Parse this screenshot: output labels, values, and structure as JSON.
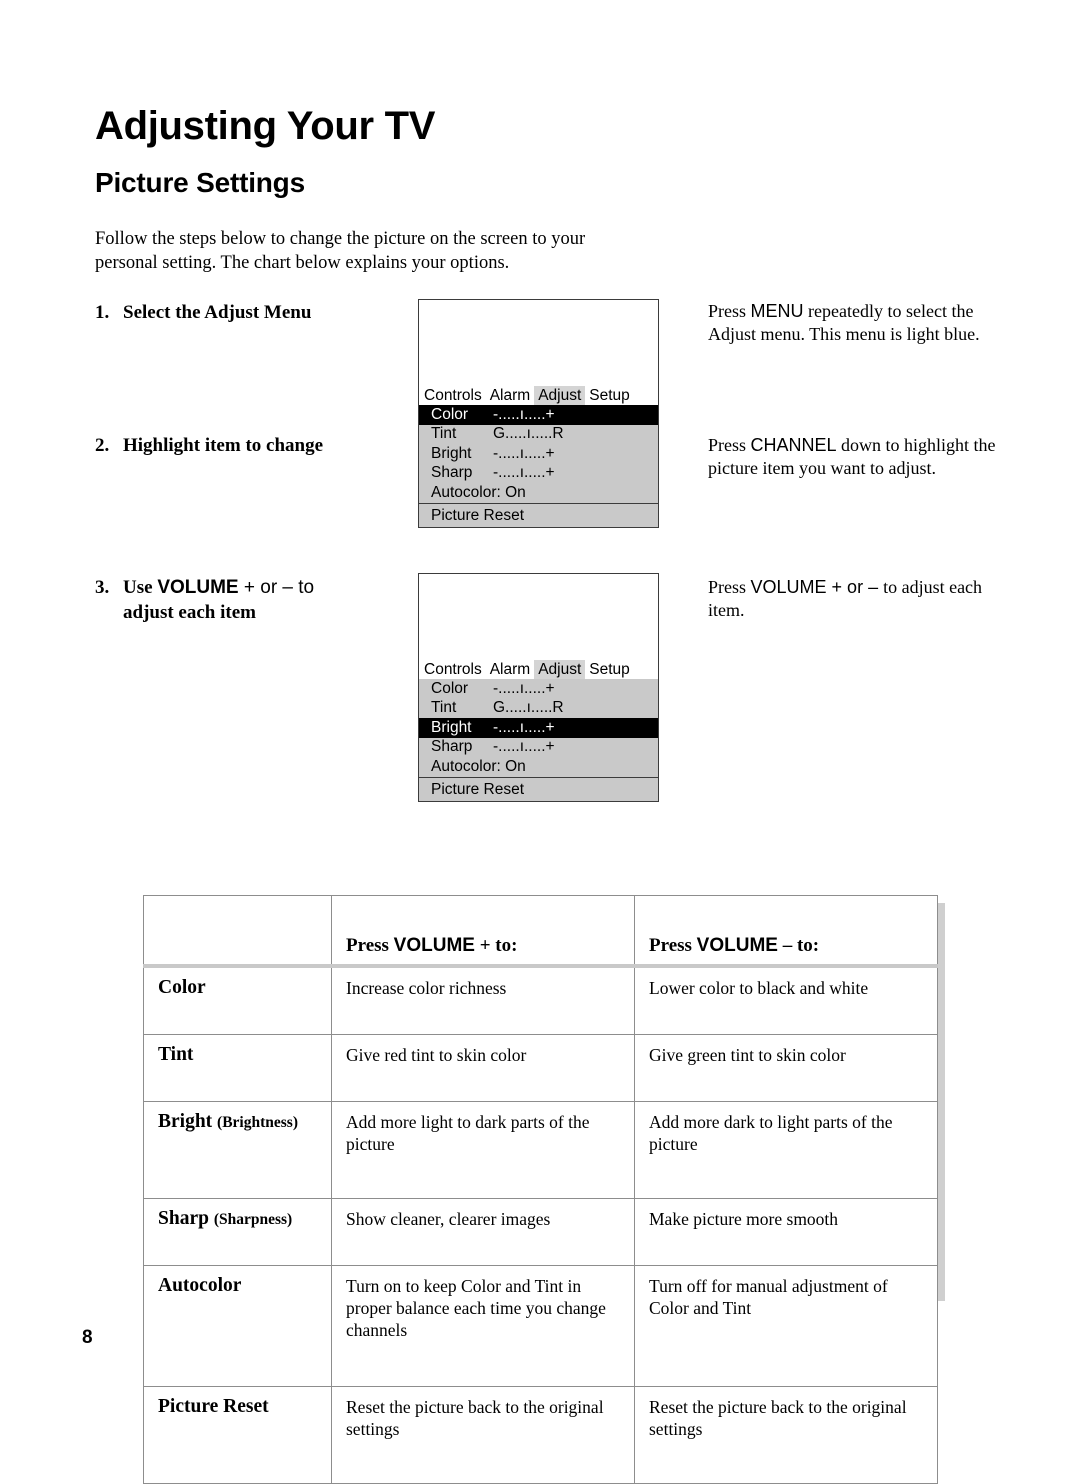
{
  "document": {
    "title": "Adjusting Your TV",
    "subtitle": "Picture Settings",
    "intro": "Follow the steps below to change the picture on the screen to your personal setting.  The chart below explains your options.",
    "page_number": "8"
  },
  "steps": [
    {
      "number": "1.",
      "text_before": "Select the Adjust Menu",
      "note_lines": "Press MENU repeatedly to select the Adjust menu.  This menu is light blue.",
      "note_keyword": "MENU"
    },
    {
      "number": "2.",
      "text_before": "Highlight item to change",
      "note_lines": "Press CHANNEL down to highlight the picture item you want to adjust.",
      "note_keyword": "CHANNEL"
    },
    {
      "number": "3.",
      "text_before": "Use ",
      "keyword": "VOLUME",
      "text_mid": " + or – to",
      "text_after": "adjust each item",
      "note_keyword": "VOLUME",
      "note_prefix": "Press ",
      "note_mid": " + or – ",
      "note_suffix": "to adjust each item."
    }
  ],
  "step_notes": {
    "note1_pre": "Press ",
    "note1_kw": "MENU",
    "note1_post": " repeatedly to select the Adjust menu.  This menu is light blue.",
    "note2_pre": "Press ",
    "note2_kw": "CHANNEL",
    "note2_post": " down to highlight the picture item you want to adjust.",
    "note3_pre": "Press ",
    "note3_kw": "VOLUME",
    "note3_sym": " + or – ",
    "note3_post": "to adjust each item."
  },
  "tv_menu": {
    "tabs": [
      "Controls",
      "Alarm",
      "Adjust",
      "Setup"
    ],
    "active_tab": "Adjust",
    "footer_item": "Picture Reset",
    "sliders": {
      "minus_plus": "-.....ı.....+",
      "green_red": "G.....ı.....R"
    },
    "autocolor_label": "Autocolor: On",
    "menu_one": {
      "selected": "Color",
      "items": [
        {
          "label": "Color",
          "bar": "-.....ı.....+"
        },
        {
          "label": "Tint",
          "bar": "G.....ı.....R"
        },
        {
          "label": "Bright",
          "bar": "-.....ı.....+"
        },
        {
          "label": "Sharp",
          "bar": "-.....ı.....+"
        },
        {
          "label": "Autocolor: On",
          "bar": ""
        }
      ]
    },
    "menu_two": {
      "selected": "Bright",
      "items": [
        {
          "label": "Color",
          "bar": "-.....ı.....+"
        },
        {
          "label": "Tint",
          "bar": "G.....ı.....R"
        },
        {
          "label": "Bright",
          "bar": "-.....ı.....+"
        },
        {
          "label": "Sharp",
          "bar": "-.....ı.....+"
        },
        {
          "label": "Autocolor: On",
          "bar": ""
        }
      ]
    }
  },
  "reference_table": {
    "headers": {
      "col1": "",
      "col2_pre": "Press ",
      "col2_kw": "VOLUME",
      "col2_post": " + to:",
      "col3_pre": "Press ",
      "col3_kw": "VOLUME",
      "col3_post": " – to:"
    },
    "rows": [
      {
        "label": "Color",
        "paren": "",
        "plus": "Increase color richness",
        "minus": "Lower color to black and white"
      },
      {
        "label": "Tint",
        "paren": "",
        "plus": "Give red tint to skin color",
        "minus": "Give green tint to skin color"
      },
      {
        "label": "Bright",
        "paren": "(Brightness)",
        "plus": "Add more light to dark parts of the picture",
        "minus": "Add more dark to light parts of the picture"
      },
      {
        "label": "Sharp",
        "paren": "(Sharpness)",
        "plus": "Show cleaner, clearer images",
        "minus": "Make picture more smooth"
      },
      {
        "label": "Autocolor",
        "paren": "",
        "plus": "Turn on to keep Color and Tint in proper balance each time you change channels",
        "minus": "Turn off for manual adjustment of Color and Tint"
      },
      {
        "label": "Picture Reset",
        "paren": "",
        "plus": "Reset the picture back to the original settings",
        "minus": "Reset the picture back to the original settings"
      }
    ]
  },
  "colors": {
    "menu_gray": "#c9c9c9",
    "tab_highlight": "#d4d4d4",
    "selected_row": "#000000",
    "shadow": "#cfcfcf"
  }
}
